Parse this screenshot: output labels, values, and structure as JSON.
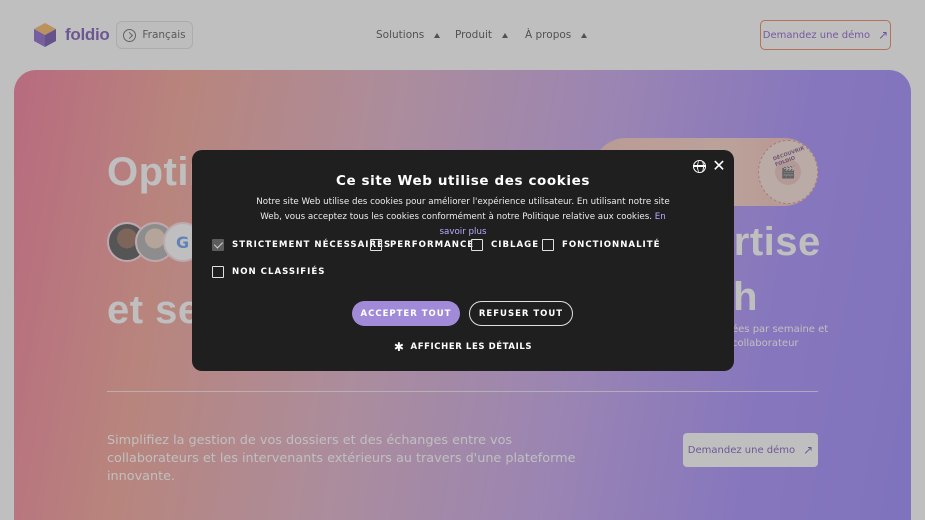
{
  "header": {
    "logo_text": "foldio",
    "language_label": "Français",
    "nav": [
      {
        "label": "Solutions"
      },
      {
        "label": "Produit"
      },
      {
        "label": "À propos"
      }
    ],
    "demo_button_label": "Demandez une démo",
    "demo_arrow": "↗"
  },
  "hero": {
    "headline_line1": "Optim",
    "headline_line2_suffix": "ertise",
    "headline_line3_prefix": "et se",
    "headline_line3_suffix": "h",
    "google_letter": "G",
    "side_text": "ées par semaine et collaborateur",
    "description": "Simplifiez la gestion de vos dossiers et des échanges entre vos collaborateurs et les intervenants extérieurs au travers d'une plateforme innovante.",
    "demo_button_label": "Demandez une démo",
    "demo_arrow": "↗",
    "badge_text": "DÉCOUVRIR FOLDIO"
  },
  "cookie_modal": {
    "title": "Ce site Web utilise des cookies",
    "body": "Notre site Web utilise des cookies pour améliorer l'expérience utilisateur. En utilisant notre site Web, vous acceptez tous les cookies conformément à notre Politique relative aux cookies.",
    "learn_more": "En savoir plus",
    "checkboxes": [
      {
        "label": "STRICTEMENT NÉCESSAIRES",
        "checked": true
      },
      {
        "label": "PERFORMANCE",
        "checked": false
      },
      {
        "label": "CIBLAGE",
        "checked": false
      },
      {
        "label": "FONCTIONNALITÉ",
        "checked": false
      },
      {
        "label": "NON CLASSIFIÉS",
        "checked": false
      }
    ],
    "accept_label": "ACCEPTER TOUT",
    "refuse_label": "REFUSER TOUT",
    "details_label": "AFFICHER LES DÉTAILS",
    "close_glyph": "✕",
    "gear_glyph": "✱",
    "accent_color": "#a18bd9"
  }
}
